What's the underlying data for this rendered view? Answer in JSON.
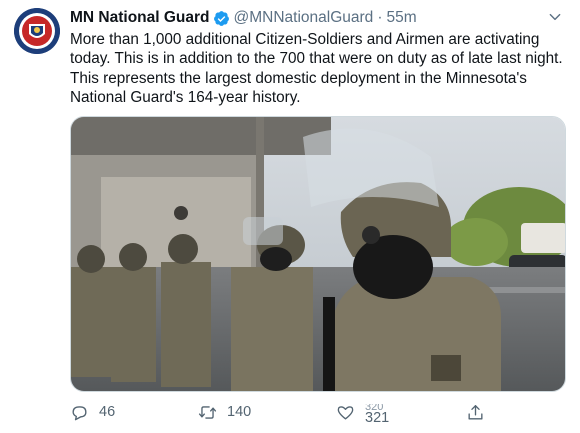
{
  "tweet": {
    "display_name": "MN National Guard",
    "handle": "@MNNationalGuard",
    "separator": "·",
    "time": "55m",
    "body": "More than 1,000 additional Citizen-Soldiers and Airmen are activating today. This is in addition to the 700 that were on duty as of late last night. This represents the largest domestic deployment in the Minnesota's National Guard's 164-year history.",
    "verified": true
  },
  "actions": {
    "replies": "46",
    "retweets": "140",
    "likes_previous": "320",
    "likes": "321"
  },
  "icons": {
    "avatar": "mn-national-guard-seal",
    "verified": "verified-badge-icon",
    "caret": "chevron-down-icon",
    "reply": "reply-icon",
    "retweet": "retweet-icon",
    "like": "heart-icon",
    "share": "share-icon"
  },
  "colors": {
    "accent": "#1d9bf0",
    "secondary_text": "#5b7083",
    "avatar_bg": "#1d3e7a"
  }
}
